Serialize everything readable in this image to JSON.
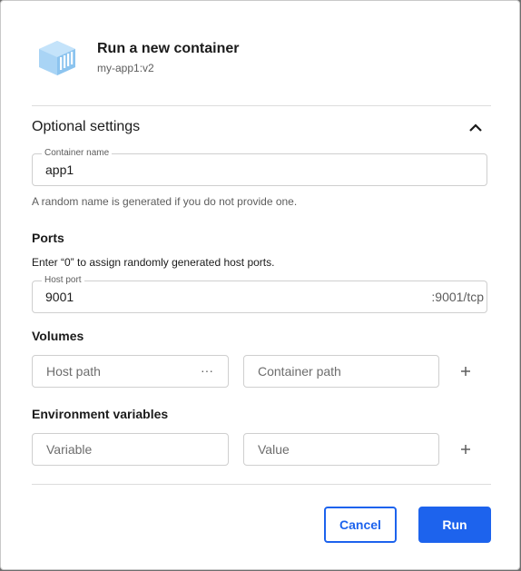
{
  "header": {
    "title": "Run a new container",
    "image": "my-app1:v2",
    "icon": "container-image-icon"
  },
  "optional_settings": {
    "title": "Optional settings",
    "collapse_icon": "chevron-up-icon"
  },
  "container_name": {
    "label": "Container name",
    "value": "app1",
    "help": "A random name is generated if you do not provide one."
  },
  "ports": {
    "title": "Ports",
    "help": "Enter “0” to assign randomly generated host ports.",
    "host_port_label": "Host port",
    "host_port_value": "9001",
    "container_port": ":9001/tcp"
  },
  "volumes": {
    "title": "Volumes",
    "host_path_placeholder": "Host path",
    "browse_label": "···",
    "container_path_placeholder": "Container path",
    "add_icon": "plus-icon"
  },
  "env": {
    "title": "Environment variables",
    "variable_placeholder": "Variable",
    "value_placeholder": "Value",
    "add_icon": "plus-icon"
  },
  "footer": {
    "cancel_label": "Cancel",
    "run_label": "Run"
  },
  "colors": {
    "accent": "#1d63ed",
    "icon_blue": "#a9d4f5"
  }
}
